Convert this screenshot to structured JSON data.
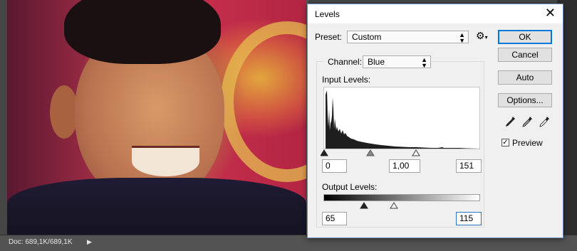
{
  "status_bar": {
    "doc_info": "Doc: 689,1K/689,1K",
    "arrow_icon": "play-arrow-icon"
  },
  "dialog": {
    "title": "Levels",
    "close_icon": "close-icon",
    "preset": {
      "label": "Preset:",
      "value": "Custom",
      "gear_icon": "gear-icon"
    },
    "channel": {
      "label": "Channel:",
      "value": "Blue"
    },
    "input_levels": {
      "label": "Input Levels:",
      "black": "0",
      "gamma": "1,00",
      "white": "151"
    },
    "output_levels": {
      "label": "Output Levels:",
      "black": "65",
      "white": "115"
    },
    "buttons": {
      "ok": "OK",
      "cancel": "Cancel",
      "auto": "Auto",
      "options": "Options..."
    },
    "eyedroppers": [
      "black-eyedropper-icon",
      "gray-eyedropper-icon",
      "white-eyedropper-icon"
    ],
    "preview": {
      "label": "Preview",
      "checked": true
    }
  }
}
